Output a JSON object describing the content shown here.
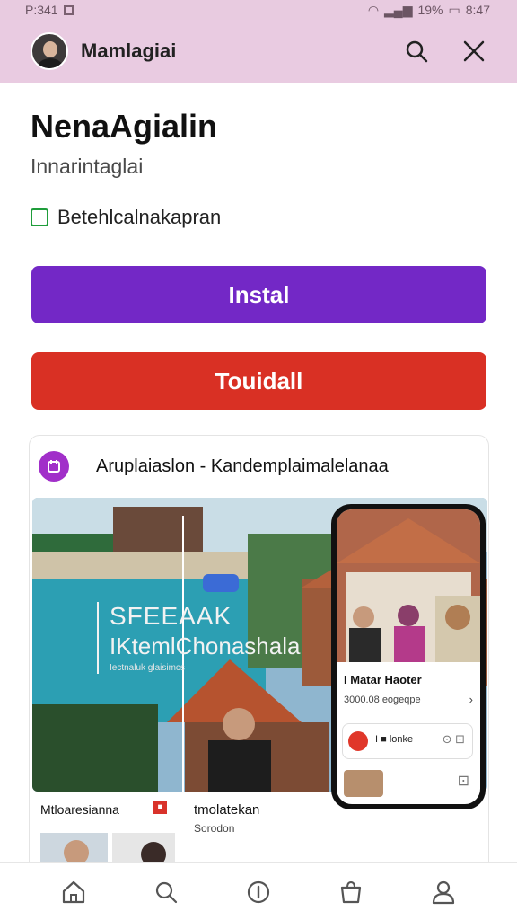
{
  "status_bar": {
    "time": "P:341",
    "battery": "19%",
    "clock_right": "8:47"
  },
  "app_bar": {
    "title": "Mamlagiai"
  },
  "main": {
    "headline": "NenaAgialin",
    "subhead": "Innarintaglai",
    "checkbox_label": "Betehlcalnakapran",
    "install_label": "Instal",
    "secondary_label": "Touidall"
  },
  "card": {
    "title": "Aruplaiaslon - Kandemplaimalelanaa",
    "hero": {
      "line1": "SFEEAAK",
      "line2": "IKtemlChonashala",
      "line3": "Iectnaluk glaisimcs"
    },
    "phone": {
      "title": "I Matar Haoter",
      "subtitle": "3000.08 eogeqpe",
      "row_text": "I ■ lonke",
      "row_icons": "⊙ ⊡"
    },
    "tile1": {
      "label": "Mtloaresianna"
    },
    "tile2": {
      "label": "tmolatekan",
      "sub": "Sorodon"
    }
  },
  "colors": {
    "accent_purple": "#7328c6",
    "accent_red": "#d93024",
    "app_bar": "#e9cbe1",
    "checkbox_green": "#1f9d3b"
  },
  "icons": {
    "app_bar": [
      "avatar",
      "search-icon",
      "close-icon"
    ],
    "bottom_nav": [
      "home-icon",
      "search-icon",
      "info-icon",
      "bag-icon",
      "profile-icon"
    ]
  }
}
